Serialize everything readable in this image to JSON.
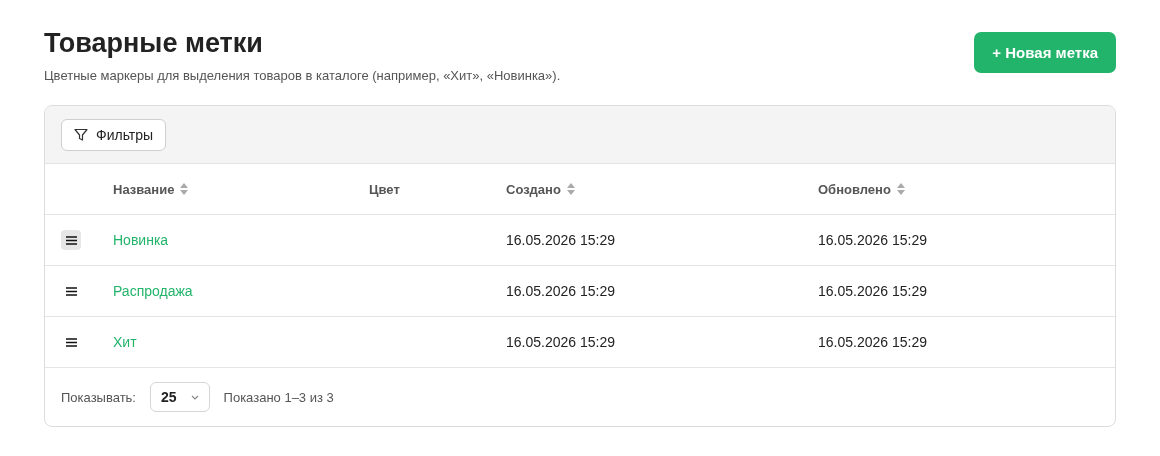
{
  "header": {
    "title": "Товарные метки",
    "subtitle": "Цветные маркеры для выделения товаров в каталоге (например, «Хит», «Новинка»).",
    "new_button": "+ Новая метка"
  },
  "toolbar": {
    "filters_button": "Фильтры"
  },
  "table": {
    "columns": [
      {
        "label": "Название",
        "sortable": true
      },
      {
        "label": "Цвет",
        "sortable": false
      },
      {
        "label": "Создано",
        "sortable": true
      },
      {
        "label": "Обновлено",
        "sortable": true
      }
    ],
    "rows": [
      {
        "name": "Новинка",
        "created": "16.05.2026 15:29",
        "updated": "16.05.2026 15:29",
        "handle_hovered": true
      },
      {
        "name": "Распродажа",
        "created": "16.05.2026 15:29",
        "updated": "16.05.2026 15:29",
        "handle_hovered": false
      },
      {
        "name": "Хит",
        "created": "16.05.2026 15:29",
        "updated": "16.05.2026 15:29",
        "handle_hovered": false
      }
    ]
  },
  "footer": {
    "page_size_label": "Показывать:",
    "page_size": "25",
    "summary": "Показано 1–3 из 3"
  }
}
